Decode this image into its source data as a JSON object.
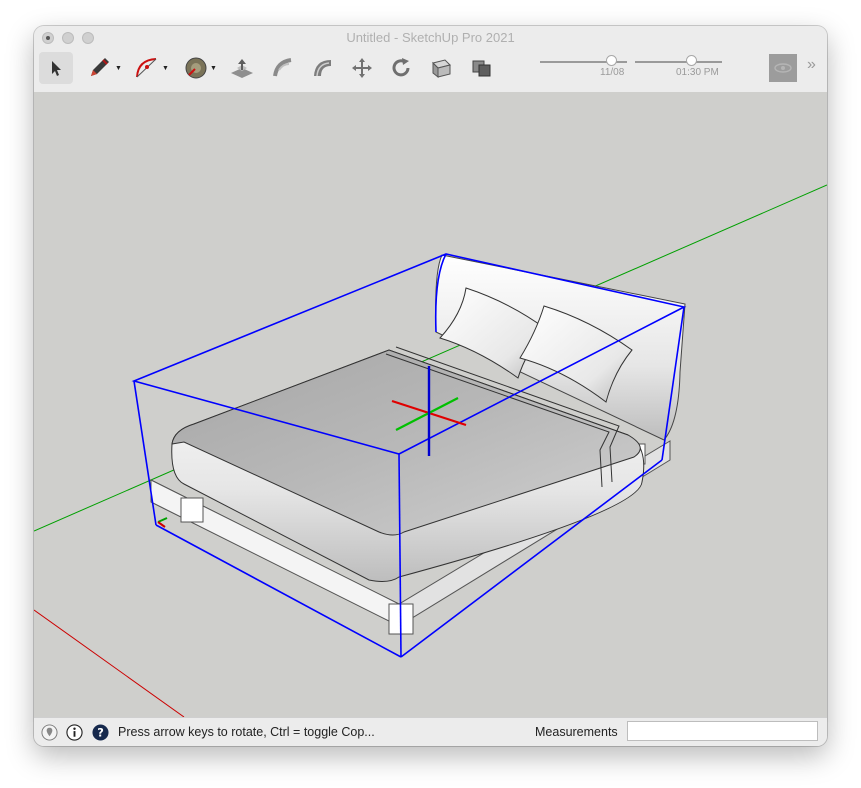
{
  "window": {
    "title": "Untitled - SketchUp Pro 2021"
  },
  "toolbar": {
    "tools": [
      {
        "name": "select",
        "icon": "arrow-cursor-icon"
      },
      {
        "name": "line",
        "icon": "pencil-icon"
      },
      {
        "name": "arc",
        "icon": "arc-icon"
      },
      {
        "name": "paint-bucket",
        "icon": "paint-bucket-icon"
      },
      {
        "name": "push-pull",
        "icon": "push-pull-icon"
      },
      {
        "name": "follow-me",
        "icon": "follow-me-icon"
      },
      {
        "name": "offset",
        "icon": "offset-icon"
      },
      {
        "name": "move",
        "icon": "move-icon"
      },
      {
        "name": "rotate",
        "icon": "rotate-icon"
      },
      {
        "name": "scale",
        "icon": "scale-icon"
      },
      {
        "name": "outer-shell",
        "icon": "outer-shell-icon"
      }
    ],
    "date_label": "11/08",
    "time_label": "01:30 PM",
    "date_level": 0.82,
    "time_level": 0.65,
    "overflow_icon": "chevron-double-right-icon"
  },
  "status": {
    "hint": "Press arrow keys to rotate, Ctrl = toggle Cop...",
    "measurements_label": "Measurements",
    "measurements_value": ""
  },
  "colors": {
    "selection": "#0000ff",
    "axis_red": "#e00000",
    "axis_green": "#00a000",
    "viewport_bg": "#cfcfcc"
  }
}
